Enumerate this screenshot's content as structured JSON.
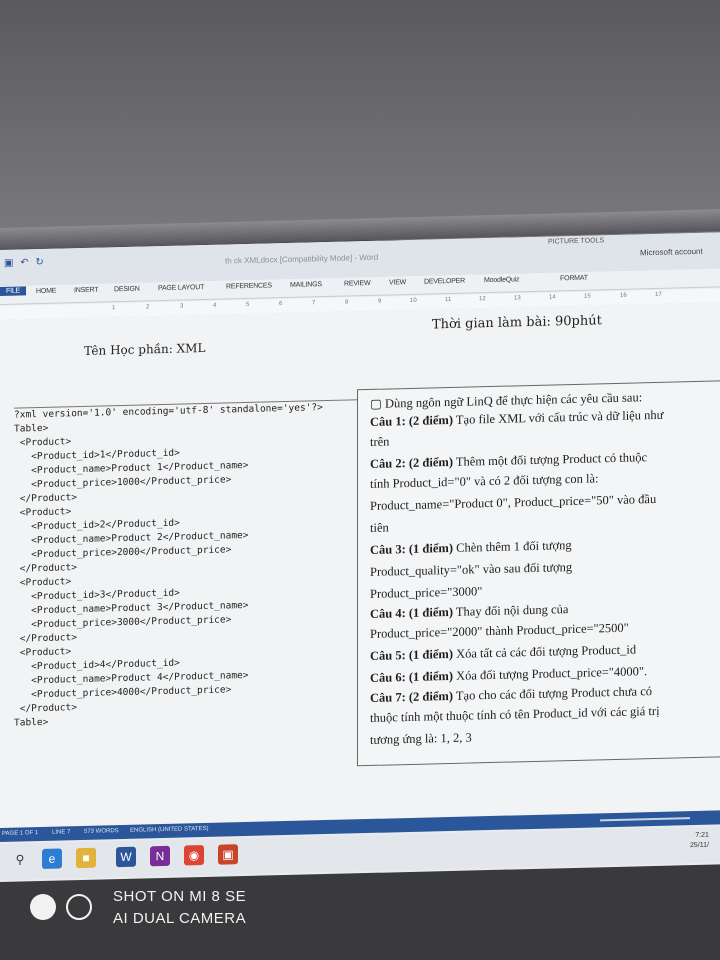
{
  "window": {
    "title": "th ck XMLdocx [Compatibility Mode] - Word",
    "picture_tools": "PICTURE TOOLS",
    "account": "Microsoft account"
  },
  "ribbon": {
    "file_tab": "FILE",
    "tabs": [
      "HOME",
      "INSERT",
      "DESIGN",
      "PAGE LAYOUT",
      "REFERENCES",
      "MAILINGS",
      "REVIEW",
      "VIEW",
      "DEVELOPER",
      "MoodleQuiz",
      "FORMAT"
    ]
  },
  "ruler": {
    "ticks": [
      "1",
      "2",
      "3",
      "4",
      "5",
      "6",
      "7",
      "8",
      "9",
      "10",
      "11",
      "12",
      "13",
      "14",
      "15",
      "16",
      "17"
    ]
  },
  "document": {
    "time_label": "Thời gian làm bài: 90phút",
    "course_label": "Tên Học phần: XML",
    "xml_lines": [
      "?xml version='1.0' encoding='utf-8' standalone='yes'?>",
      "Table>",
      " <Product>",
      "   <Product_id>1</Product_id>",
      "   <Product_name>Product 1</Product_name>",
      "   <Product_price>1000</Product_price>",
      " </Product>",
      " <Product>",
      "   <Product_id>2</Product_id>",
      "   <Product_name>Product 2</Product_name>",
      "   <Product_price>2000</Product_price>",
      " </Product>",
      " <Product>",
      "   <Product_id>3</Product_id>",
      "   <Product_name>Product 3</Product_name>",
      "   <Product_price>3000</Product_price>",
      " </Product>",
      " <Product>",
      "   <Product_id>4</Product_id>",
      "   <Product_name>Product 4</Product_name>",
      "   <Product_price>4000</Product_price>",
      " </Product>",
      "Table>"
    ],
    "questions_intro": "Dùng ngôn ngữ LinQ để thực hiện các yêu cầu sau:",
    "questions": [
      {
        "label": "Câu 1: (2 điểm)",
        "lines": [
          "Tạo file XML với cấu trúc và dữ liệu như",
          "trên"
        ]
      },
      {
        "label": "Câu 2: (2 điểm)",
        "lines": [
          "Thêm một đối tượng Product có thuộc",
          "tính Product_id=\"0\" và có 2 đối tượng con là:",
          "Product_name=\"Product 0\", Product_price=\"50\" vào đầu",
          "tiên"
        ]
      },
      {
        "label": "Câu 3: (1 điểm)",
        "lines": [
          "Chèn thêm 1 đối tượng",
          "Product_quality=\"ok\" vào sau đối tượng",
          "Product_price=\"3000\""
        ]
      },
      {
        "label": "Câu 4: (1 điểm)",
        "lines": [
          "Thay đổi nội dung của",
          "Product_price=\"2000\" thành Product_price=\"2500\""
        ]
      },
      {
        "label": "Câu 5: (1 điểm)",
        "lines": [
          "Xóa tất cả các đối tượng Product_id"
        ]
      },
      {
        "label": "Câu 6: (1 điểm)",
        "lines": [
          "Xóa đối tượng Product_price=\"4000\"."
        ]
      },
      {
        "label": "Câu 7: (2 điểm)",
        "lines": [
          "Tạo cho các đối tượng Product chưa có",
          "thuộc tính một thuộc tính có tên Product_id  với các giá trị",
          "tương ứng là: 1, 2, 3"
        ]
      }
    ]
  },
  "statusbar": {
    "page": "PAGE 1 OF 1",
    "line": "LINE 7",
    "words": "573 WORDS",
    "language": "ENGLISH (UNITED STATES)"
  },
  "taskbar": {
    "clock_time": "7:21",
    "clock_date": "25/11/"
  },
  "watermark": {
    "line1": "SHOT ON MI 8 SE",
    "line2": "AI DUAL CAMERA"
  },
  "colors": {
    "word_blue": "#2b579a",
    "page_bg": "#f2f3f4"
  }
}
